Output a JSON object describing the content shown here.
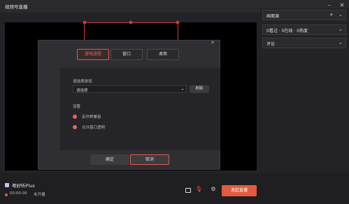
{
  "app": {
    "title": "视频号直播"
  },
  "window_controls": {
    "minimize": "–",
    "close": "✕"
  },
  "right_panel": {
    "rows": [
      {
        "label": "画面源",
        "icons": [
          "+",
          "⌄"
        ]
      },
      {
        "label": "0看过 · 0在线 · 0热度",
        "icons": [
          "⌄"
        ]
      },
      {
        "label": "评论",
        "icons": [
          "⌄"
        ]
      }
    ]
  },
  "dialog": {
    "tabs": [
      {
        "label": "游戏进程",
        "active": true
      },
      {
        "label": "窗口",
        "active": false
      },
      {
        "label": "桌面",
        "active": false
      }
    ],
    "select_game_label": "请选择游戏",
    "select_placeholder": "请选择",
    "refresh_label": "刷新",
    "settings_label": "设置",
    "options": [
      {
        "label": "反作弊兼容",
        "checked": true
      },
      {
        "label": "允许窗口透明",
        "checked": true
      }
    ],
    "confirm_label": "确定",
    "cancel_label": "取消"
  },
  "footer": {
    "account_name": "粤好听Plus",
    "status_time": "00:00:00",
    "status_text": "未开播",
    "go_live_label": "发起直播"
  },
  "colors": {
    "accent": "#e55a3f",
    "border_accent": "#d33b3b"
  }
}
